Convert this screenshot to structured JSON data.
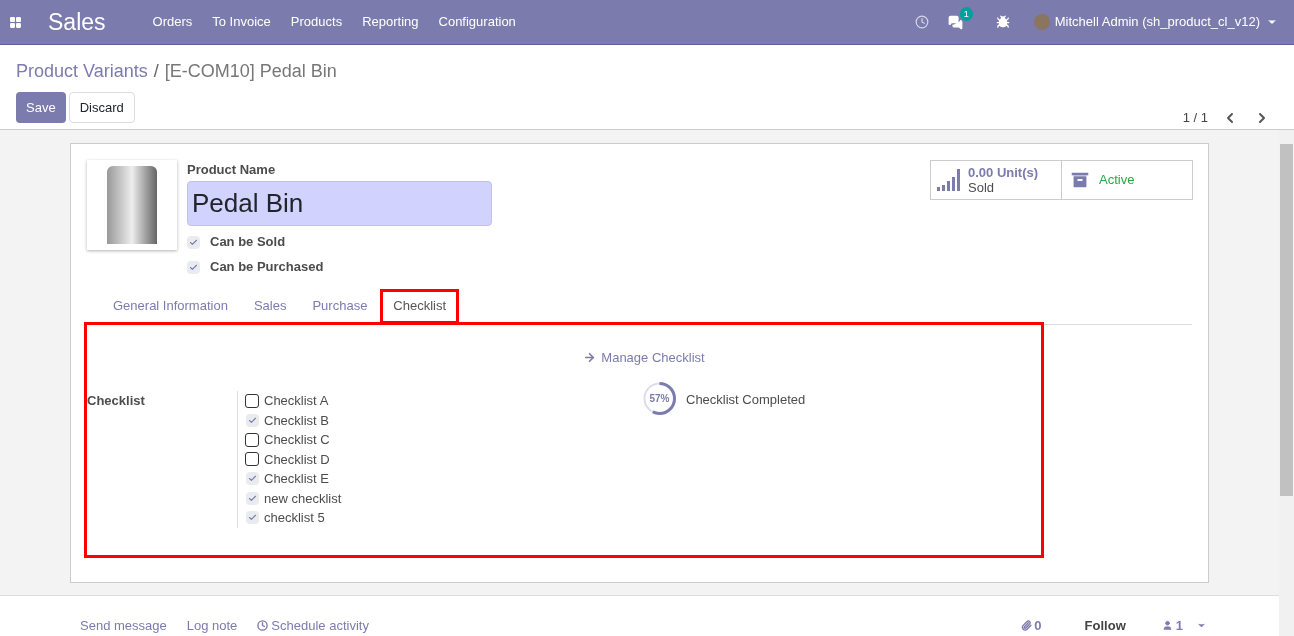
{
  "navbar": {
    "app_name": "Sales",
    "menu": [
      "Orders",
      "To Invoice",
      "Products",
      "Reporting",
      "Configuration"
    ],
    "messages_badge": "1",
    "user": "Mitchell Admin (sh_product_cl_v12)"
  },
  "breadcrumb": {
    "parent": "Product Variants",
    "separator": "/",
    "current": "[E-COM10] Pedal Bin"
  },
  "buttons": {
    "save": "Save",
    "discard": "Discard"
  },
  "pager": "1 / 1",
  "form": {
    "name_label": "Product Name",
    "name_value": "Pedal Bin",
    "options": [
      {
        "label": "Can be Sold",
        "checked": true
      },
      {
        "label": "Can be Purchased",
        "checked": true
      }
    ],
    "stat_buttons": [
      {
        "kind": "sold",
        "value": "0.00 Unit(s)",
        "label": "Sold"
      },
      {
        "kind": "active",
        "label": "Active"
      }
    ],
    "tabs": [
      {
        "label": "General Information",
        "selected": false
      },
      {
        "label": "Sales",
        "selected": false
      },
      {
        "label": "Purchase",
        "selected": false
      },
      {
        "label": "Checklist",
        "selected": true
      }
    ],
    "manage_link": "Manage Checklist",
    "checklist_label": "Checklist",
    "checklist": [
      {
        "label": "Checklist A",
        "checked": false
      },
      {
        "label": "Checklist B",
        "checked": true
      },
      {
        "label": "Checklist C",
        "checked": false
      },
      {
        "label": "Checklist D",
        "checked": false
      },
      {
        "label": "Checklist E",
        "checked": true
      },
      {
        "label": "new checklist",
        "checked": true
      },
      {
        "label": "checklist 5",
        "checked": true
      }
    ],
    "progress": {
      "level": 0.57,
      "reading": "57%",
      "label": "Checklist Completed"
    }
  },
  "chatter": {
    "send_message": "Send message",
    "log_note": "Log note",
    "schedule": "Schedule activity",
    "attachments": "0",
    "follow": "Follow",
    "followers": "1"
  }
}
